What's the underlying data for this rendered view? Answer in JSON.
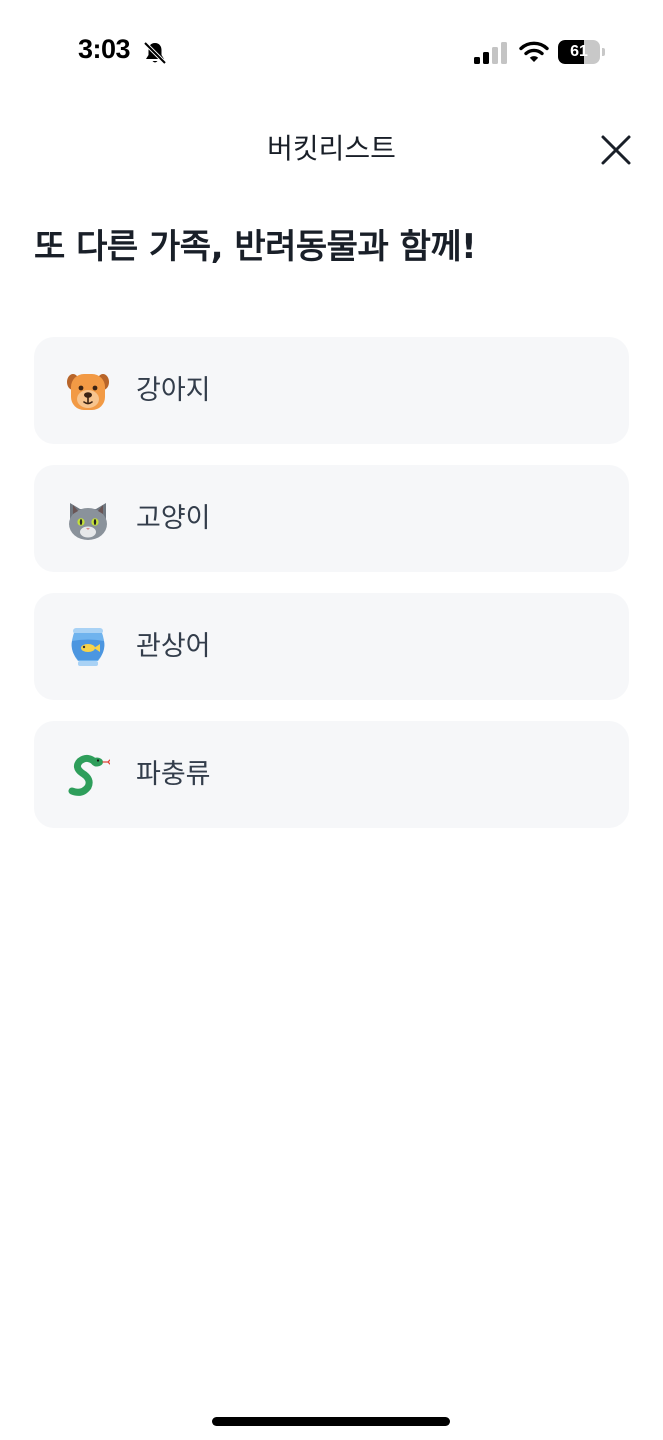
{
  "status_bar": {
    "time": "3:03",
    "battery_level": "61",
    "battery_fraction": 0.61,
    "icons": [
      "bell-muted-icon",
      "signal-icon",
      "wifi-icon",
      "battery-icon"
    ]
  },
  "header": {
    "title": "버킷리스트",
    "close_icon": "close-icon"
  },
  "heading": "또 다른 가족, 반려동물과 함께!",
  "categories": [
    {
      "label": "강아지",
      "icon": "dog-icon"
    },
    {
      "label": "고양이",
      "icon": "cat-icon"
    },
    {
      "label": "관상어",
      "icon": "fishbowl-icon"
    },
    {
      "label": "파충류",
      "icon": "snake-icon"
    }
  ],
  "colors": {
    "card_background": "#f6f7f9",
    "text_primary": "#191f28",
    "text_secondary": "#333d4b"
  }
}
